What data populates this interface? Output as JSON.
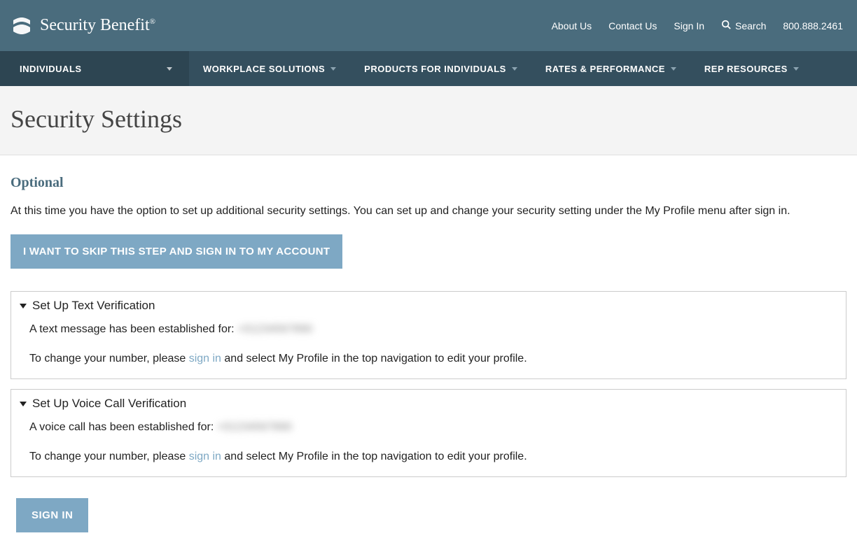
{
  "header": {
    "brand": "Security Benefit",
    "links": {
      "about": "About Us",
      "contact": "Contact Us",
      "signin": "Sign In",
      "search": "Search",
      "phone": "800.888.2461"
    }
  },
  "nav": {
    "individuals": "INDIVIDUALS",
    "items": [
      "WORKPLACE SOLUTIONS",
      "PRODUCTS FOR INDIVIDUALS",
      "RATES & PERFORMANCE",
      "REP RESOURCES"
    ]
  },
  "page": {
    "title": "Security Settings",
    "optional_heading": "Optional",
    "description": "At this time you have the option to set up additional security settings. You can set up and change your security setting under the My Profile menu after sign in.",
    "skip_button": "I WANT TO SKIP THIS STEP AND SIGN IN TO MY ACCOUNT",
    "signin_button": "SIGN IN"
  },
  "panels": {
    "text_verification": {
      "title": "Set Up Text Verification",
      "established_prefix": "A text message has been established for: ",
      "established_value": "+01234567890",
      "change_prefix": "To change your number, please ",
      "signin_link": "sign in",
      "change_suffix": " and select My Profile in the top navigation to edit your profile."
    },
    "voice_verification": {
      "title": "Set Up Voice Call Verification",
      "established_prefix": "A voice call has been established for: ",
      "established_value": "+01234567890",
      "change_prefix": "To change your number, please ",
      "signin_link": "sign in",
      "change_suffix": " and select My Profile in the top navigation to edit your profile."
    }
  }
}
